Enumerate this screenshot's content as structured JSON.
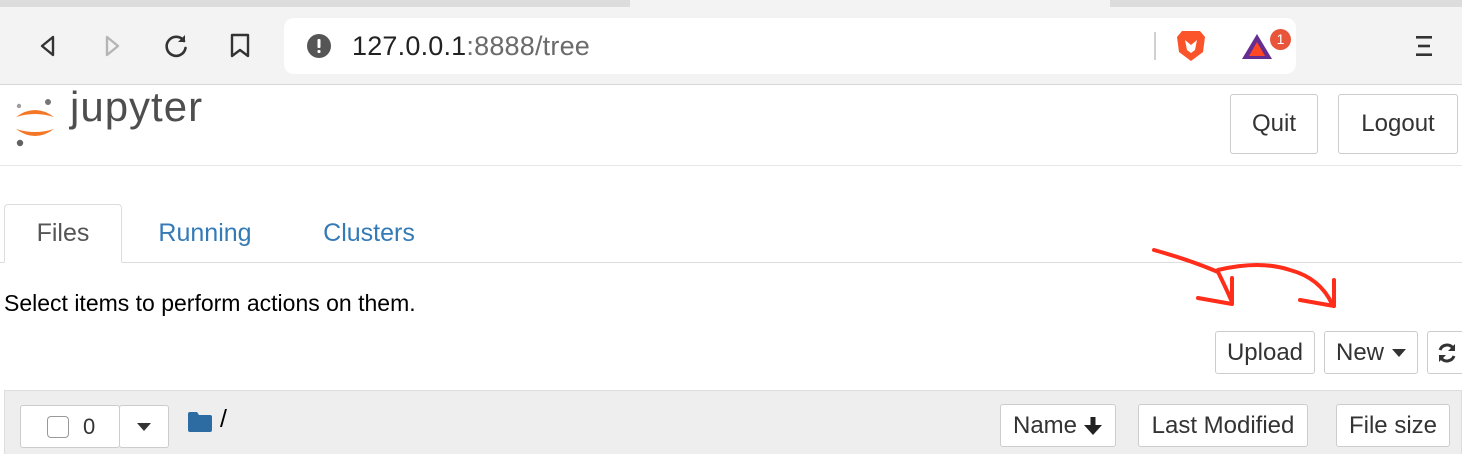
{
  "browser": {
    "url_host": "127.0.0.1",
    "url_rest": ":8888/tree",
    "extension_badge_count": "1"
  },
  "header": {
    "logo_text": "jupyter",
    "quit_label": "Quit",
    "logout_label": "Logout"
  },
  "tabs": [
    {
      "label": "Files",
      "active": true
    },
    {
      "label": "Running",
      "active": false
    },
    {
      "label": "Clusters",
      "active": false
    }
  ],
  "main": {
    "hint": "Select items to perform actions on them.",
    "upload_label": "Upload",
    "new_label": "New"
  },
  "list_header": {
    "selected_count": "0",
    "breadcrumb_root": "/",
    "sort_name_label": "Name",
    "sort_modified_label": "Last Modified",
    "sort_size_label": "File size"
  },
  "colors": {
    "link": "#337ab7",
    "jupyter_orange": "#f37726",
    "annotation_arrows": "#ff2d1a"
  },
  "icons": [
    "back-icon",
    "forward-icon",
    "reload-icon",
    "bookmark-icon",
    "info-icon",
    "brave-lion-icon",
    "bat-rewards-icon",
    "menu-icon",
    "folder-icon",
    "caret-down-icon",
    "arrow-down-icon",
    "refresh-icon"
  ]
}
